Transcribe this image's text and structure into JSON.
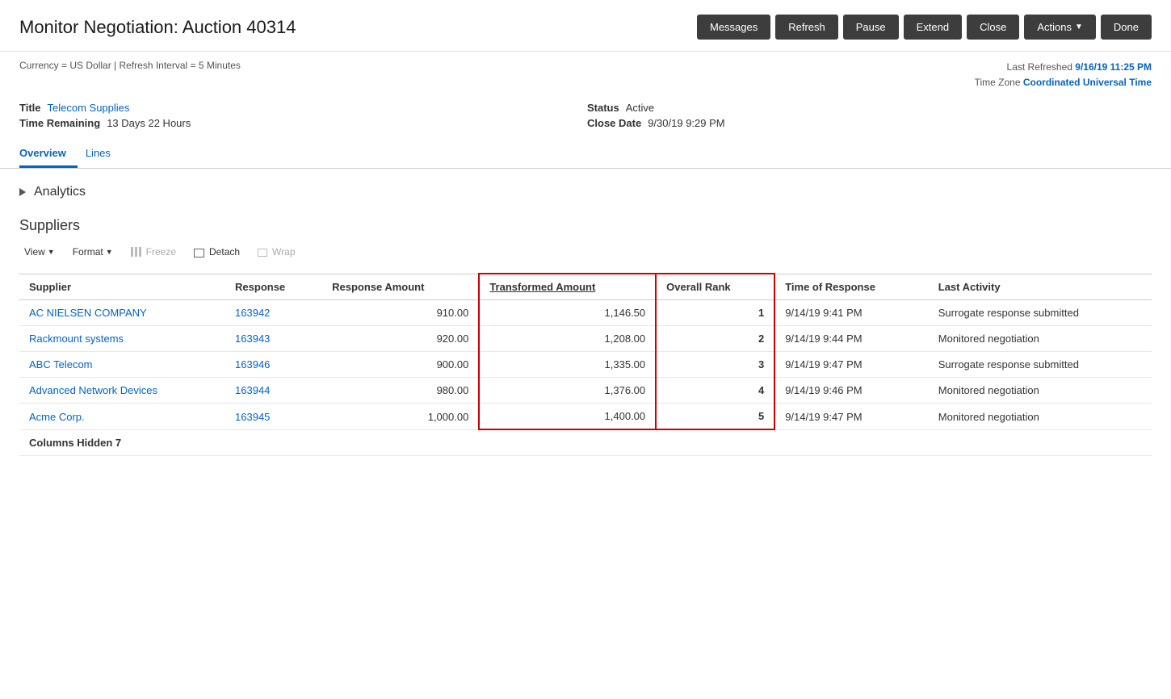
{
  "header": {
    "title": "Monitor Negotiation: Auction 40314",
    "buttons": {
      "messages": "Messages",
      "refresh": "Refresh",
      "pause": "Pause",
      "extend": "Extend",
      "close": "Close",
      "actions": "Actions",
      "done": "Done"
    }
  },
  "infoBar": {
    "left": "Currency = US Dollar | Refresh Interval = 5 Minutes",
    "lastRefreshedLabel": "Last Refreshed",
    "lastRefreshedValue": "9/16/19 11:25 PM",
    "timeZoneLabel": "Time Zone",
    "timeZoneValue": "Coordinated Universal Time"
  },
  "details": {
    "titleLabel": "Title",
    "titleValue": "Telecom Supplies",
    "timeRemainingLabel": "Time Remaining",
    "timeRemainingValue": "13 Days 22 Hours",
    "statusLabel": "Status",
    "statusValue": "Active",
    "closeDateLabel": "Close Date",
    "closeDateValue": "9/30/19 9:29 PM"
  },
  "tabs": {
    "overview": "Overview",
    "lines": "Lines"
  },
  "analytics": {
    "title": "Analytics"
  },
  "suppliers": {
    "title": "Suppliers",
    "toolbar": {
      "view": "View",
      "format": "Format",
      "freeze": "Freeze",
      "detach": "Detach",
      "wrap": "Wrap"
    },
    "columns": {
      "supplier": "Supplier",
      "response": "Response",
      "responseAmount": "Response Amount",
      "transformedAmount": "Transformed Amount",
      "overallRank": "Overall Rank",
      "timeOfResponse": "Time of Response",
      "lastActivity": "Last Activity"
    },
    "rows": [
      {
        "supplier": "AC NIELSEN COMPANY",
        "response": "163942",
        "responseAmount": "910.00",
        "transformedAmount": "1,146.50",
        "overallRank": "1",
        "timeOfResponse": "9/14/19 9:41 PM",
        "lastActivity": "Surrogate response submitted"
      },
      {
        "supplier": "Rackmount systems",
        "response": "163943",
        "responseAmount": "920.00",
        "transformedAmount": "1,208.00",
        "overallRank": "2",
        "timeOfResponse": "9/14/19 9:44 PM",
        "lastActivity": "Monitored negotiation"
      },
      {
        "supplier": "ABC Telecom",
        "response": "163946",
        "responseAmount": "900.00",
        "transformedAmount": "1,335.00",
        "overallRank": "3",
        "timeOfResponse": "9/14/19 9:47 PM",
        "lastActivity": "Surrogate response submitted"
      },
      {
        "supplier": "Advanced Network Devices",
        "response": "163944",
        "responseAmount": "980.00",
        "transformedAmount": "1,376.00",
        "overallRank": "4",
        "timeOfResponse": "9/14/19 9:46 PM",
        "lastActivity": "Monitored negotiation"
      },
      {
        "supplier": "Acme Corp.",
        "response": "163945",
        "responseAmount": "1,000.00",
        "transformedAmount": "1,400.00",
        "overallRank": "5",
        "timeOfResponse": "9/14/19 9:47 PM",
        "lastActivity": "Monitored negotiation"
      }
    ],
    "columnsHidden": "Columns Hidden 7"
  }
}
